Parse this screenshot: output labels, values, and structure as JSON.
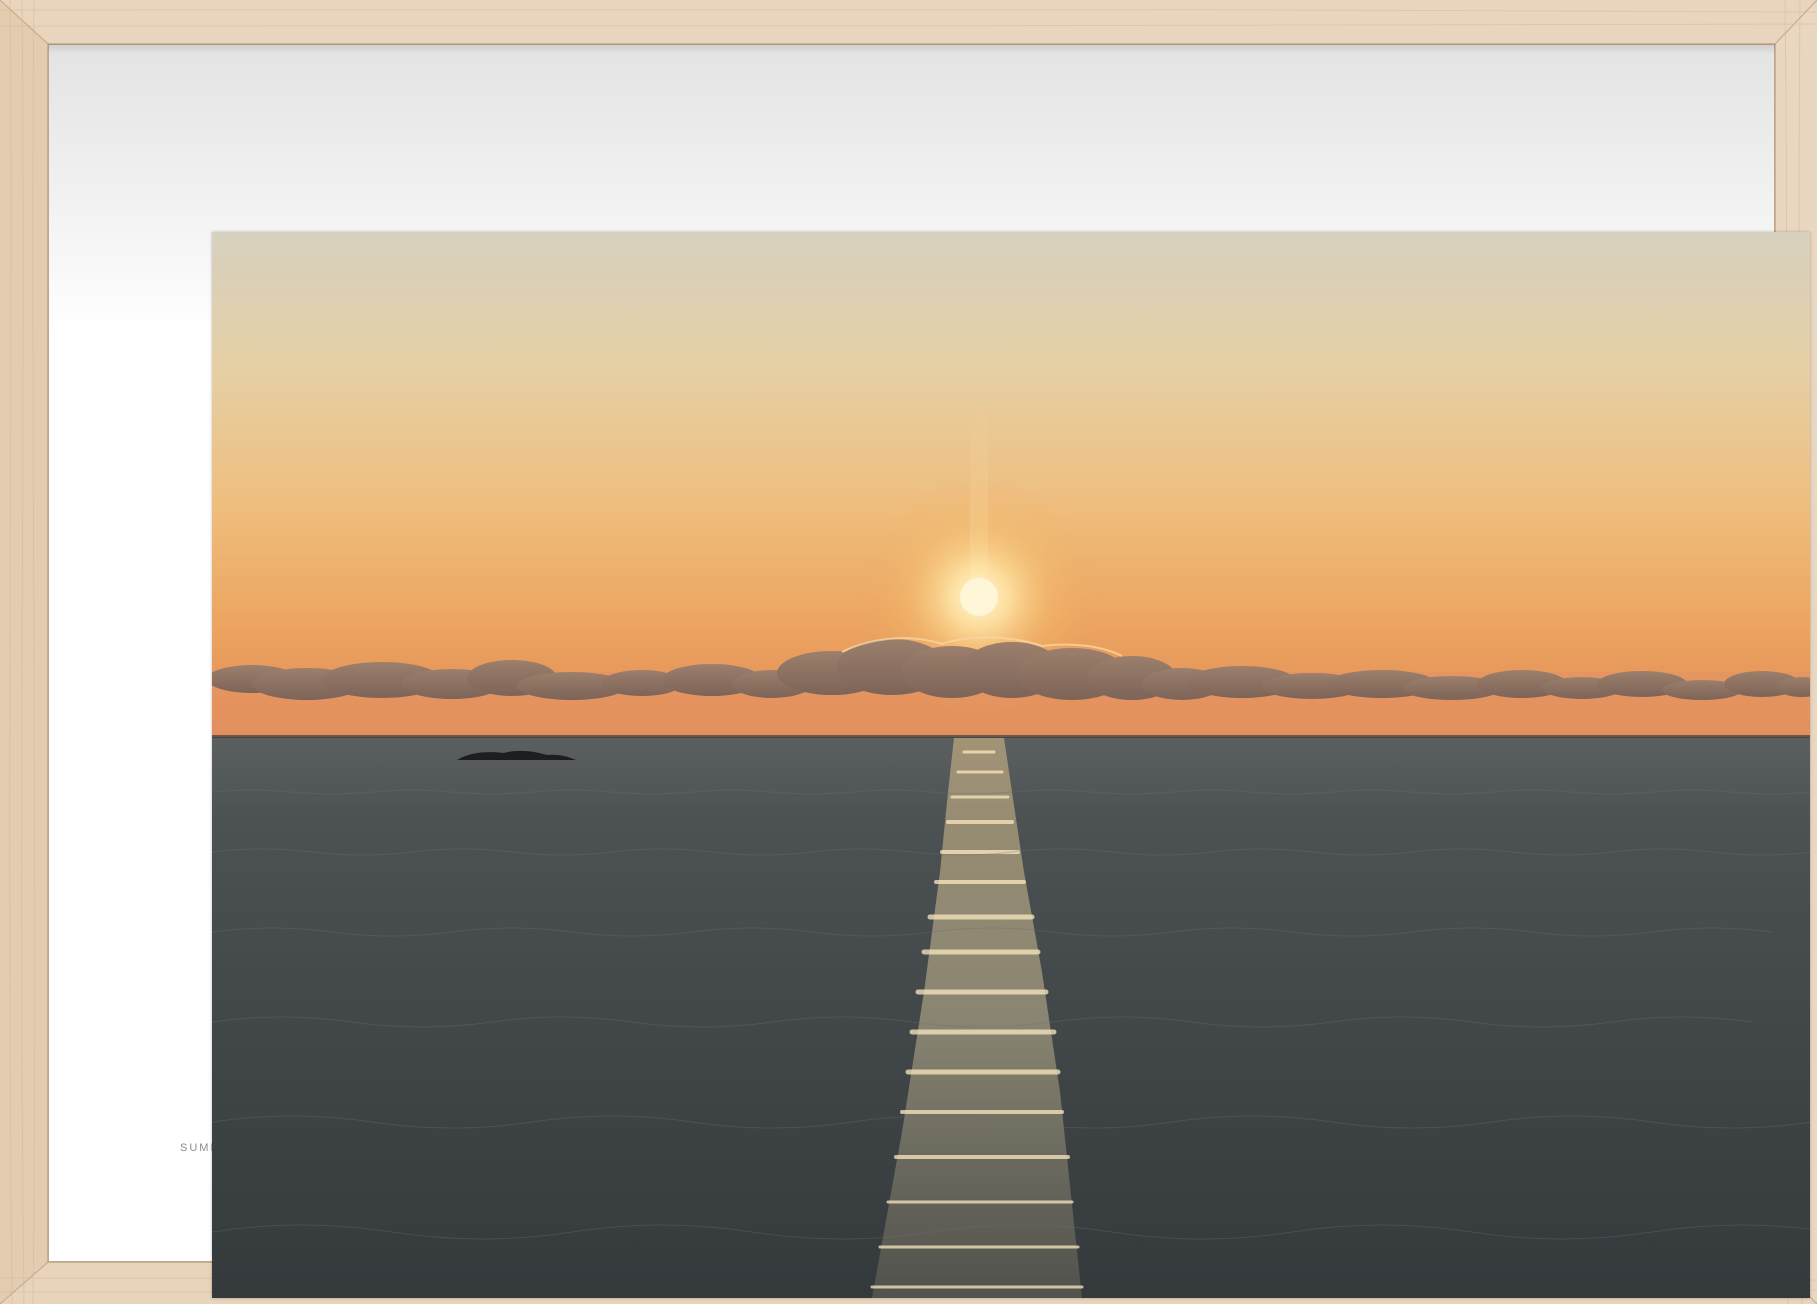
{
  "scene": {
    "caption_text": "SUMM",
    "frame_color": "#e8d3bb",
    "mat_color": "#ffffff",
    "sky_top_color": "#d9d2bd",
    "sky_mid_color": "#ebc48c",
    "sky_horizon_color": "#e99a55",
    "sea_color": "#3c4144",
    "sun_color": "#fff6d8",
    "clouds_color": "#8a6f62"
  }
}
